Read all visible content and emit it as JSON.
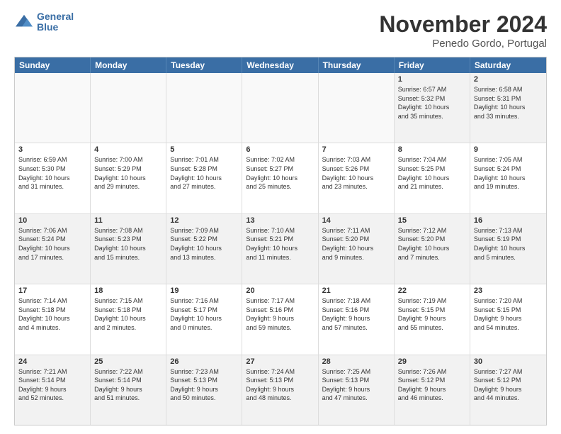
{
  "logo": {
    "line1": "General",
    "line2": "Blue"
  },
  "title": "November 2024",
  "location": "Penedo Gordo, Portugal",
  "days": [
    "Sunday",
    "Monday",
    "Tuesday",
    "Wednesday",
    "Thursday",
    "Friday",
    "Saturday"
  ],
  "weeks": [
    [
      {
        "day": "",
        "content": "",
        "empty": true
      },
      {
        "day": "",
        "content": "",
        "empty": true
      },
      {
        "day": "",
        "content": "",
        "empty": true
      },
      {
        "day": "",
        "content": "",
        "empty": true
      },
      {
        "day": "",
        "content": "",
        "empty": true
      },
      {
        "day": "1",
        "content": "Sunrise: 6:57 AM\nSunset: 5:32 PM\nDaylight: 10 hours\nand 35 minutes."
      },
      {
        "day": "2",
        "content": "Sunrise: 6:58 AM\nSunset: 5:31 PM\nDaylight: 10 hours\nand 33 minutes."
      }
    ],
    [
      {
        "day": "3",
        "content": "Sunrise: 6:59 AM\nSunset: 5:30 PM\nDaylight: 10 hours\nand 31 minutes."
      },
      {
        "day": "4",
        "content": "Sunrise: 7:00 AM\nSunset: 5:29 PM\nDaylight: 10 hours\nand 29 minutes."
      },
      {
        "day": "5",
        "content": "Sunrise: 7:01 AM\nSunset: 5:28 PM\nDaylight: 10 hours\nand 27 minutes."
      },
      {
        "day": "6",
        "content": "Sunrise: 7:02 AM\nSunset: 5:27 PM\nDaylight: 10 hours\nand 25 minutes."
      },
      {
        "day": "7",
        "content": "Sunrise: 7:03 AM\nSunset: 5:26 PM\nDaylight: 10 hours\nand 23 minutes."
      },
      {
        "day": "8",
        "content": "Sunrise: 7:04 AM\nSunset: 5:25 PM\nDaylight: 10 hours\nand 21 minutes."
      },
      {
        "day": "9",
        "content": "Sunrise: 7:05 AM\nSunset: 5:24 PM\nDaylight: 10 hours\nand 19 minutes."
      }
    ],
    [
      {
        "day": "10",
        "content": "Sunrise: 7:06 AM\nSunset: 5:24 PM\nDaylight: 10 hours\nand 17 minutes."
      },
      {
        "day": "11",
        "content": "Sunrise: 7:08 AM\nSunset: 5:23 PM\nDaylight: 10 hours\nand 15 minutes."
      },
      {
        "day": "12",
        "content": "Sunrise: 7:09 AM\nSunset: 5:22 PM\nDaylight: 10 hours\nand 13 minutes."
      },
      {
        "day": "13",
        "content": "Sunrise: 7:10 AM\nSunset: 5:21 PM\nDaylight: 10 hours\nand 11 minutes."
      },
      {
        "day": "14",
        "content": "Sunrise: 7:11 AM\nSunset: 5:20 PM\nDaylight: 10 hours\nand 9 minutes."
      },
      {
        "day": "15",
        "content": "Sunrise: 7:12 AM\nSunset: 5:20 PM\nDaylight: 10 hours\nand 7 minutes."
      },
      {
        "day": "16",
        "content": "Sunrise: 7:13 AM\nSunset: 5:19 PM\nDaylight: 10 hours\nand 5 minutes."
      }
    ],
    [
      {
        "day": "17",
        "content": "Sunrise: 7:14 AM\nSunset: 5:18 PM\nDaylight: 10 hours\nand 4 minutes."
      },
      {
        "day": "18",
        "content": "Sunrise: 7:15 AM\nSunset: 5:18 PM\nDaylight: 10 hours\nand 2 minutes."
      },
      {
        "day": "19",
        "content": "Sunrise: 7:16 AM\nSunset: 5:17 PM\nDaylight: 10 hours\nand 0 minutes."
      },
      {
        "day": "20",
        "content": "Sunrise: 7:17 AM\nSunset: 5:16 PM\nDaylight: 9 hours\nand 59 minutes."
      },
      {
        "day": "21",
        "content": "Sunrise: 7:18 AM\nSunset: 5:16 PM\nDaylight: 9 hours\nand 57 minutes."
      },
      {
        "day": "22",
        "content": "Sunrise: 7:19 AM\nSunset: 5:15 PM\nDaylight: 9 hours\nand 55 minutes."
      },
      {
        "day": "23",
        "content": "Sunrise: 7:20 AM\nSunset: 5:15 PM\nDaylight: 9 hours\nand 54 minutes."
      }
    ],
    [
      {
        "day": "24",
        "content": "Sunrise: 7:21 AM\nSunset: 5:14 PM\nDaylight: 9 hours\nand 52 minutes."
      },
      {
        "day": "25",
        "content": "Sunrise: 7:22 AM\nSunset: 5:14 PM\nDaylight: 9 hours\nand 51 minutes."
      },
      {
        "day": "26",
        "content": "Sunrise: 7:23 AM\nSunset: 5:13 PM\nDaylight: 9 hours\nand 50 minutes."
      },
      {
        "day": "27",
        "content": "Sunrise: 7:24 AM\nSunset: 5:13 PM\nDaylight: 9 hours\nand 48 minutes."
      },
      {
        "day": "28",
        "content": "Sunrise: 7:25 AM\nSunset: 5:13 PM\nDaylight: 9 hours\nand 47 minutes."
      },
      {
        "day": "29",
        "content": "Sunrise: 7:26 AM\nSunset: 5:12 PM\nDaylight: 9 hours\nand 46 minutes."
      },
      {
        "day": "30",
        "content": "Sunrise: 7:27 AM\nSunset: 5:12 PM\nDaylight: 9 hours\nand 44 minutes."
      }
    ]
  ]
}
